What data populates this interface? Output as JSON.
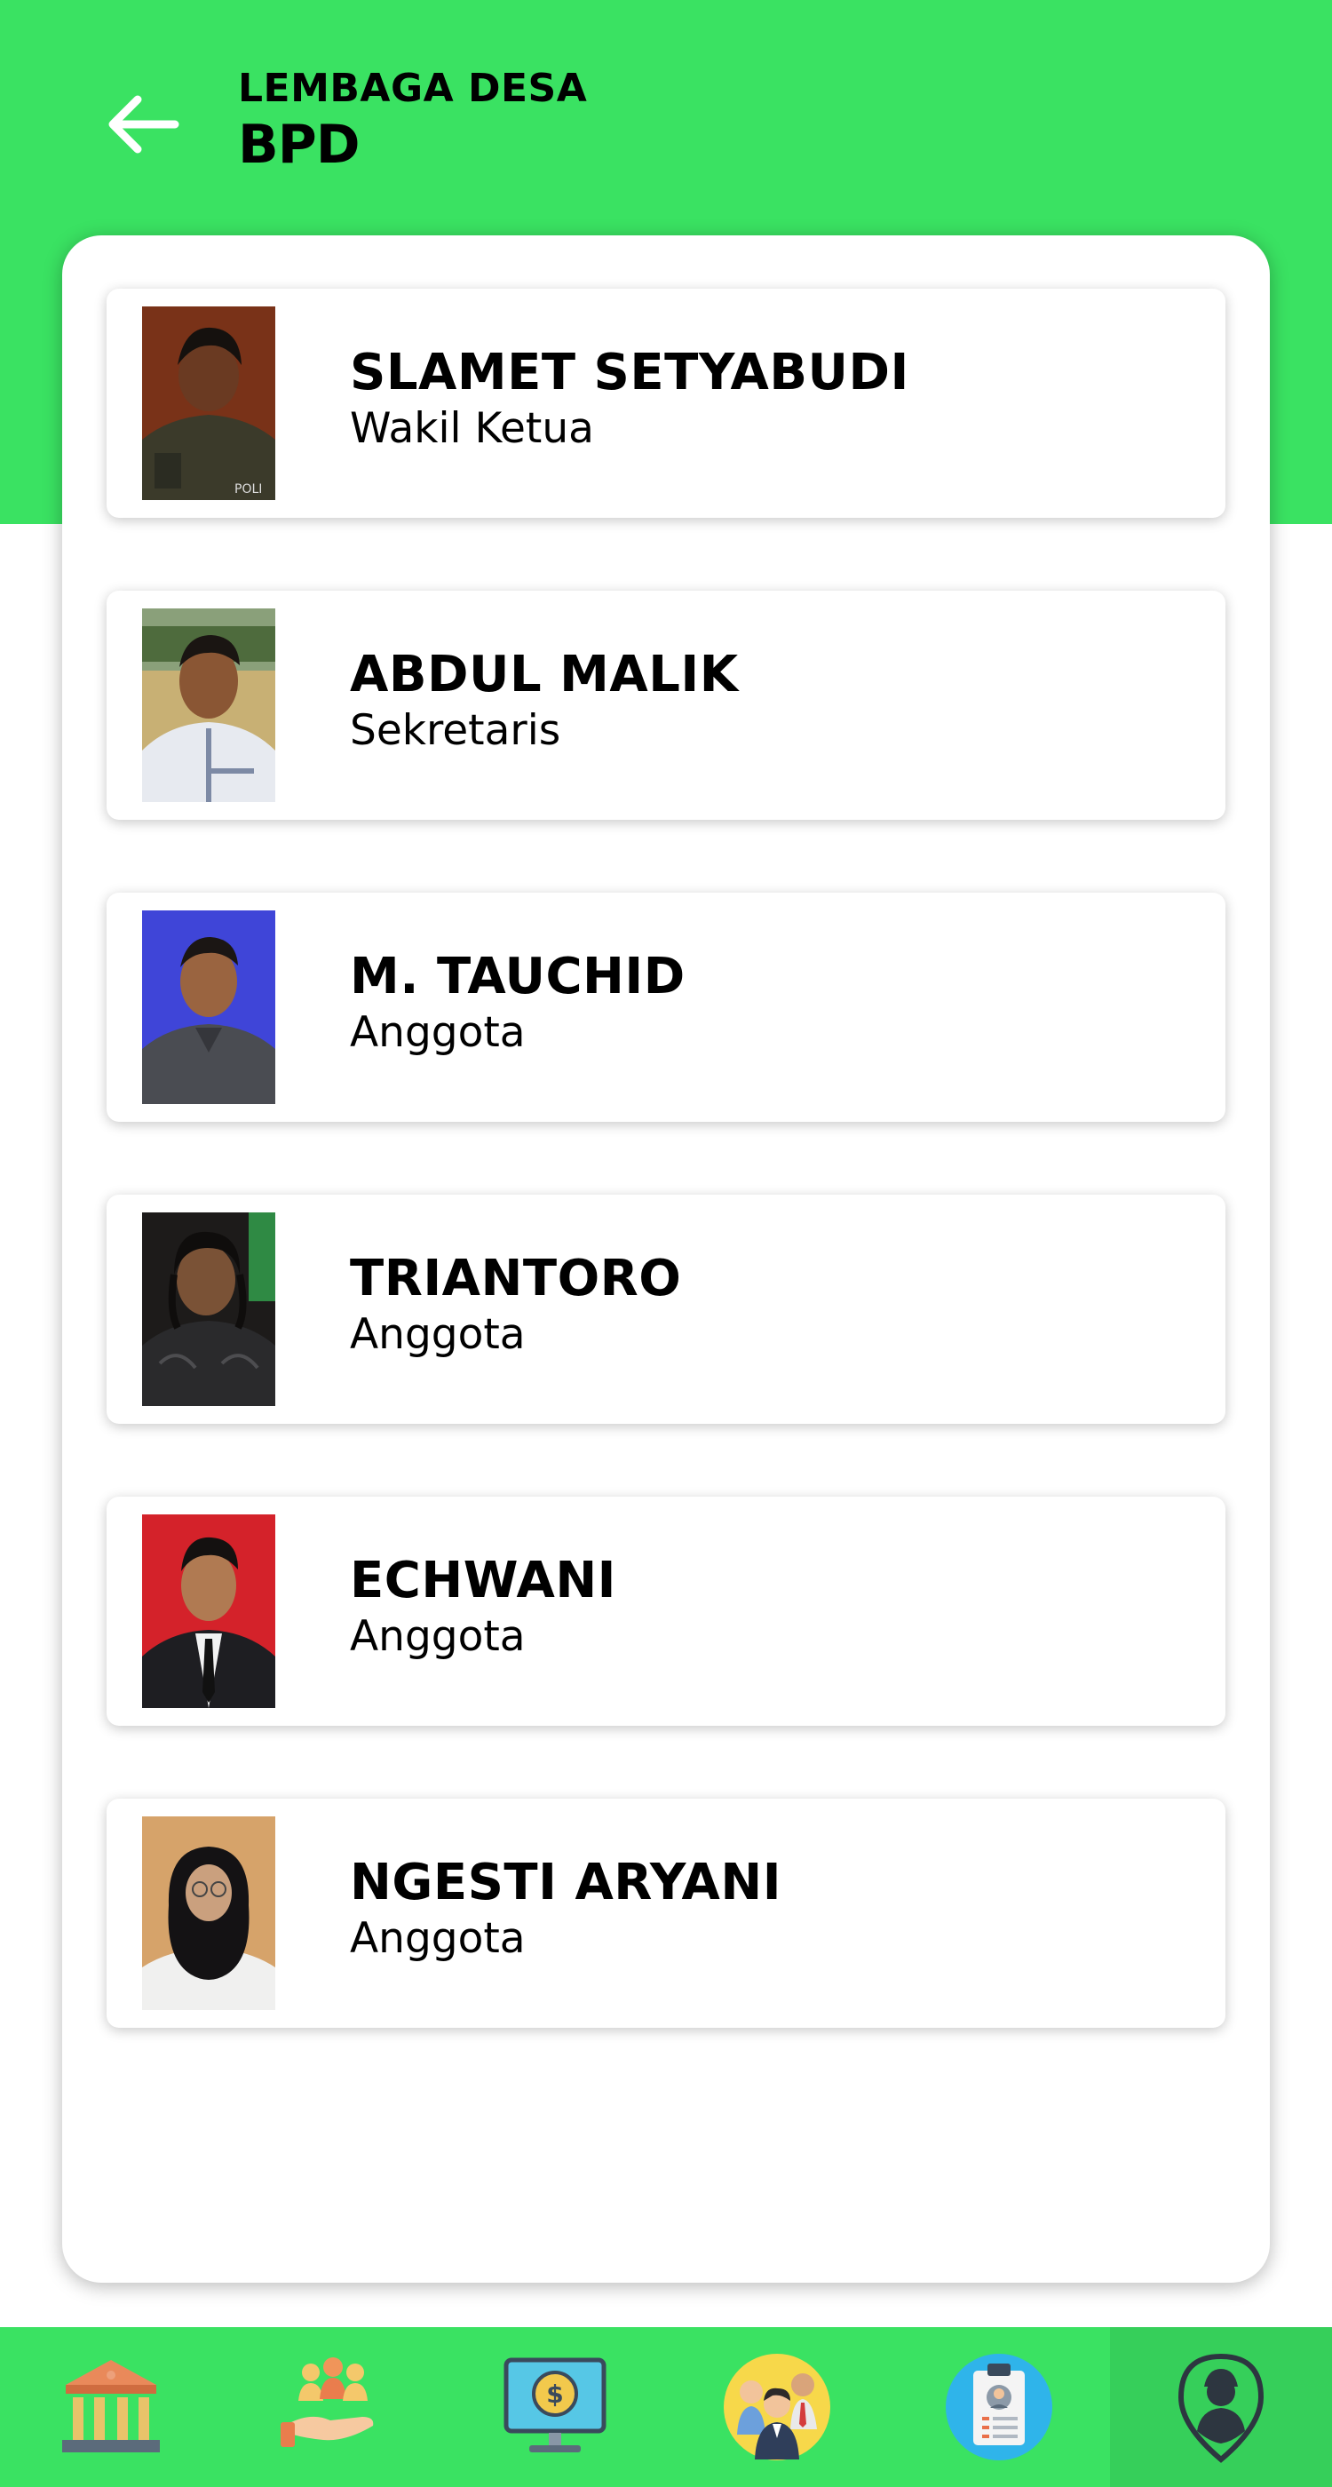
{
  "header": {
    "subtitle": "LEMBAGA DESA",
    "title": "BPD",
    "background_color": "#3ae262"
  },
  "members": [
    {
      "name": "SLAMET SETYABUDI",
      "role": "Wakil Ketua"
    },
    {
      "name": "ABDUL MALIK",
      "role": "Sekretaris"
    },
    {
      "name": "M. TAUCHID",
      "role": "Anggota"
    },
    {
      "name": "TRIANTORO",
      "role": "Anggota"
    },
    {
      "name": "ECHWANI",
      "role": "Anggota"
    },
    {
      "name": "NGESTI ARYANI",
      "role": "Anggota"
    }
  ],
  "bottom_nav": {
    "items": [
      {
        "icon": "bank-building-icon"
      },
      {
        "icon": "helping-hand-people-icon"
      },
      {
        "icon": "money-monitor-icon"
      },
      {
        "icon": "group-people-icon"
      },
      {
        "icon": "id-card-icon"
      },
      {
        "icon": "user-location-pin-icon",
        "active": true
      }
    ]
  }
}
